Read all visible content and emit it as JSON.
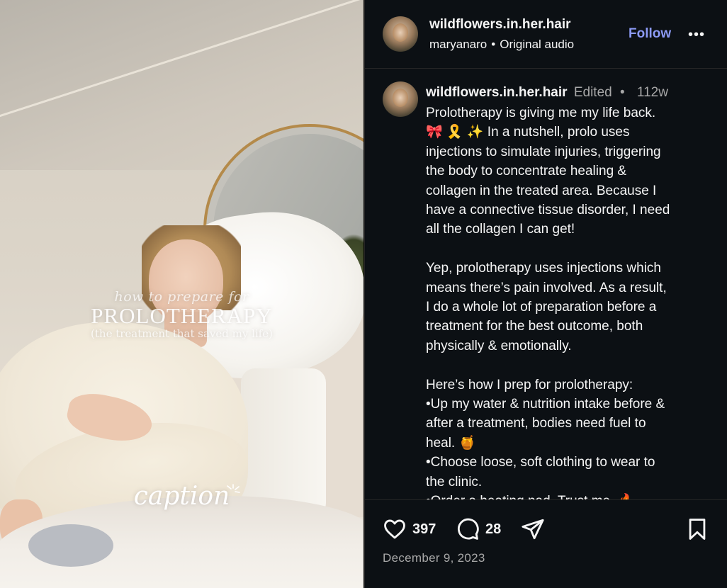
{
  "media": {
    "overlay_small": "how to prepare for",
    "overlay_big": "PROLOTHERAPY",
    "overlay_sub": "(the treatment that saved my life)",
    "overlay_caption": "caption"
  },
  "header": {
    "username": "wildflowers.in.her.hair",
    "audio_author": "maryanaro",
    "audio_label": "Original audio",
    "separator": "•",
    "follow_label": "Follow",
    "more_label": "•••"
  },
  "caption": {
    "username": "wildflowers.in.her.hair",
    "edited": "Edited",
    "separator": "•",
    "time_ago": "112w",
    "lines": [
      "Prolotherapy is giving me my life back.",
      "🎀 🎗️ ✨ In a nutshell, prolo uses",
      "injections to simulate injuries, triggering",
      "the body to concentrate healing &",
      "collagen in the treated area. Because I",
      "have a connective tissue disorder, I need",
      "all the collagen I can get!",
      "",
      "Yep, prolotherapy uses injections which",
      "means there’s pain involved. As a result,",
      "I do a whole lot of preparation before a",
      "treatment for the best outcome, both",
      "physically & emotionally.",
      "",
      "Here’s how I prep for prolotherapy:",
      "•Up my water & nutrition intake before &",
      "after a treatment, bodies need fuel to",
      "heal. 🍯",
      "•Choose loose, soft clothing to wear to",
      "the clinic.",
      "•Order a heating pad. Trust me. 🔥"
    ]
  },
  "actions": {
    "like_count": "397",
    "comment_count": "28",
    "date": "December 9, 2023"
  },
  "colors": {
    "panel_bg": "#0c1014",
    "follow": "#8c9af5",
    "secondary_text": "#a8a8a8"
  },
  "icons": {
    "like": "heart-icon",
    "comment": "comment-icon",
    "share": "share-icon",
    "save": "bookmark-icon",
    "more": "more-icon"
  }
}
